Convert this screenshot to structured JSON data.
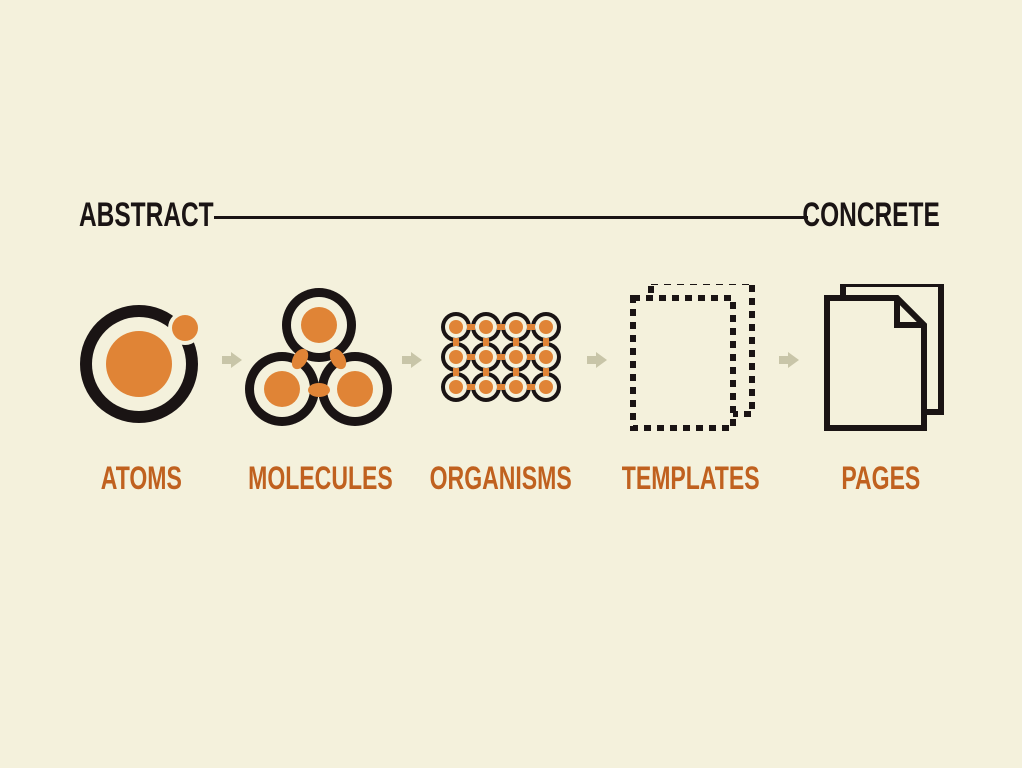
{
  "scale": {
    "left_label": "ABSTRACT",
    "right_label": "CONCRETE"
  },
  "stages": [
    {
      "label": "ATOMS",
      "icon": "atom-icon"
    },
    {
      "label": "MOLECULES",
      "icon": "molecule-icon"
    },
    {
      "label": "ORGANISMS",
      "icon": "organism-icon"
    },
    {
      "label": "TEMPLATES",
      "icon": "template-icon"
    },
    {
      "label": "PAGES",
      "icon": "pages-icon"
    }
  ],
  "colors": {
    "background": "#f4f1dc",
    "ink": "#1a1414",
    "accent": "#e08436",
    "label": "#c0611f",
    "arrow": "#c8c5a8"
  }
}
